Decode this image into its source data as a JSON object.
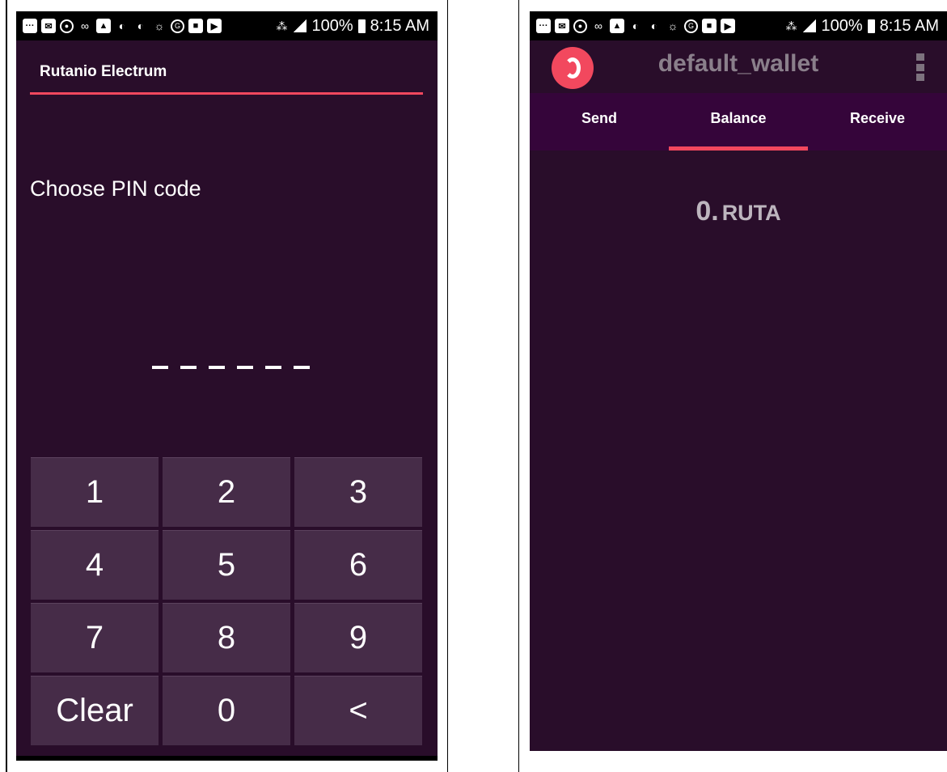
{
  "status_bar": {
    "battery_text": "100%",
    "time": "8:15 AM",
    "icons": [
      "messages-icon",
      "mail-icon",
      "sync-icon",
      "voicemail-icon",
      "gallery-icon",
      "app-icon",
      "app-icon",
      "weather-icon",
      "google-icon",
      "app-icon",
      "youtube-icon",
      "vibrate-icon",
      "signal-icon",
      "battery-icon"
    ]
  },
  "pin_screen": {
    "app_title": "Rutanio Electrum",
    "prompt": "Choose PIN code",
    "pin_length": 6,
    "keys": [
      "1",
      "2",
      "3",
      "4",
      "5",
      "6",
      "7",
      "8",
      "9",
      "Clear",
      "0",
      "<"
    ]
  },
  "wallet_screen": {
    "wallet_name": "default_wallet",
    "tabs": [
      {
        "label": "Send",
        "active": false
      },
      {
        "label": "Balance",
        "active": true
      },
      {
        "label": "Receive",
        "active": false
      }
    ],
    "balance_amount": "0.",
    "balance_unit": "RUTA"
  },
  "colors": {
    "background": "#290d2a",
    "accent": "#f2485e",
    "key": "#462c48",
    "tab_bar": "#35053a"
  }
}
